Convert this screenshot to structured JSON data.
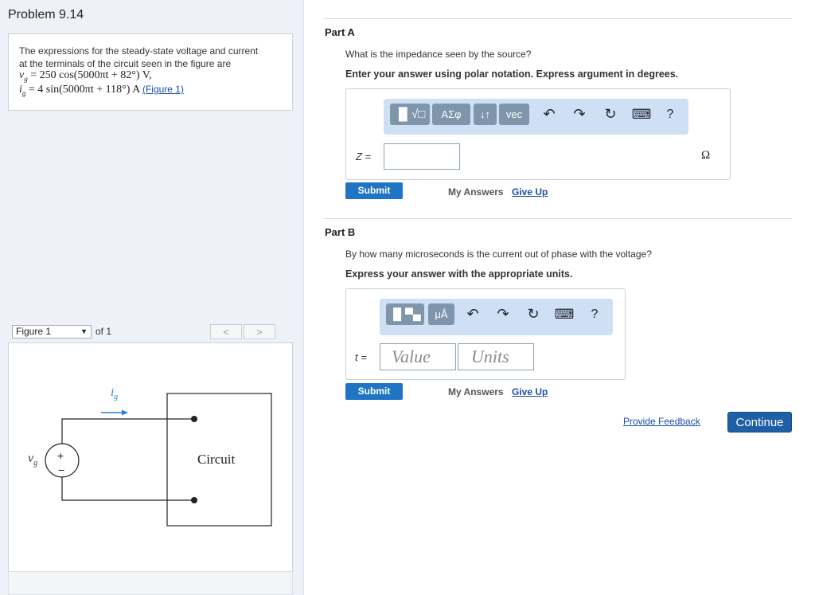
{
  "problem": {
    "title": "Problem 9.14",
    "statement_line1": "The expressions for the steady-state voltage and current",
    "statement_line2": "at the terminals of the circuit seen in the figure are",
    "vg_lhs": "v",
    "vg_sub": "g",
    "vg_rhs": " = 250 cos(5000πt + 82°) V,",
    "ig_lhs": "i",
    "ig_sub": "g",
    "ig_rhs": " = 4 sin(5000πt + 118°) A",
    "figure_link": "(Figure 1)"
  },
  "figure": {
    "select_value": "Figure 1",
    "of_label": "of 1",
    "prev_label": "<",
    "next_label": ">",
    "circuit_label": "Circuit",
    "ig_label": "i",
    "ig_sub": "g",
    "vg_label": "v",
    "vg_sub": "g",
    "plus": "+",
    "minus": "−"
  },
  "partA": {
    "title": "Part A",
    "question": "What is the impedance seen by the source?",
    "instruction": "Enter your answer using polar notation. Express argument in degrees.",
    "toolbar": {
      "templates_label": "▐▌√□",
      "greek_label": "ΑΣφ",
      "arrows_label": "↓↑",
      "vec_label": "vec",
      "undo_icon": "↶",
      "redo_icon": "↷",
      "reset_icon": "↻",
      "keyboard_icon": "⌨",
      "help_label": "?"
    },
    "var_label": "Z =",
    "input_value": "",
    "unit": "Ω",
    "submit": "Submit",
    "my_answers": "My Answers",
    "give_up": "Give Up"
  },
  "partB": {
    "title": "Part B",
    "question": "By how many microseconds is the current out of phase with the voltage?",
    "instruction": "Express your answer with the appropriate units.",
    "toolbar": {
      "templates_label": "▐▌▀▄",
      "units_label": "μÅ",
      "undo_icon": "↶",
      "redo_icon": "↷",
      "reset_icon": "↻",
      "keyboard_icon": "⌨",
      "help_label": "?"
    },
    "var_label": "t =",
    "value_placeholder": "Value",
    "units_placeholder": "Units",
    "submit": "Submit",
    "my_answers": "My Answers",
    "give_up": "Give Up"
  },
  "footer": {
    "feedback": "Provide Feedback",
    "continue": "Continue"
  },
  "colors": {
    "accent": "#1f74c4",
    "toolbar_bg": "#cfe0f4",
    "toolbar_btn": "#7f95ab",
    "continue_bg": "#1f5fa6",
    "link": "#1a4fa8"
  }
}
